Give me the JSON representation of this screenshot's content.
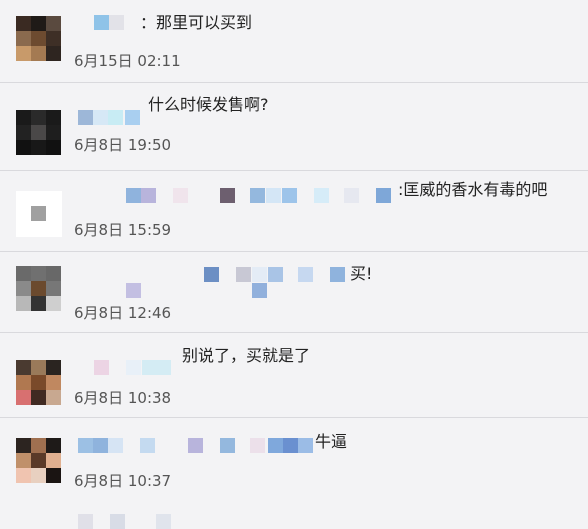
{
  "comments": [
    {
      "text": "：那里可以买到",
      "time": "6月15日 02:11"
    },
    {
      "text": "什么时候发售啊?",
      "time": "6月8日 19:50"
    },
    {
      "text": ":匡威的香水有毒的吧",
      "time": "6月8日 15:59"
    },
    {
      "text": "买!",
      "time": "6月8日 12:46"
    },
    {
      "text": "别说了，买就是了",
      "time": "6月8日 10:38"
    },
    {
      "text": "牛逼",
      "time": "6月8日 10:37"
    }
  ],
  "colors": {
    "background": "#f3f3f5",
    "divider": "#d9d9dd",
    "text": "#222222",
    "time": "#555555"
  }
}
